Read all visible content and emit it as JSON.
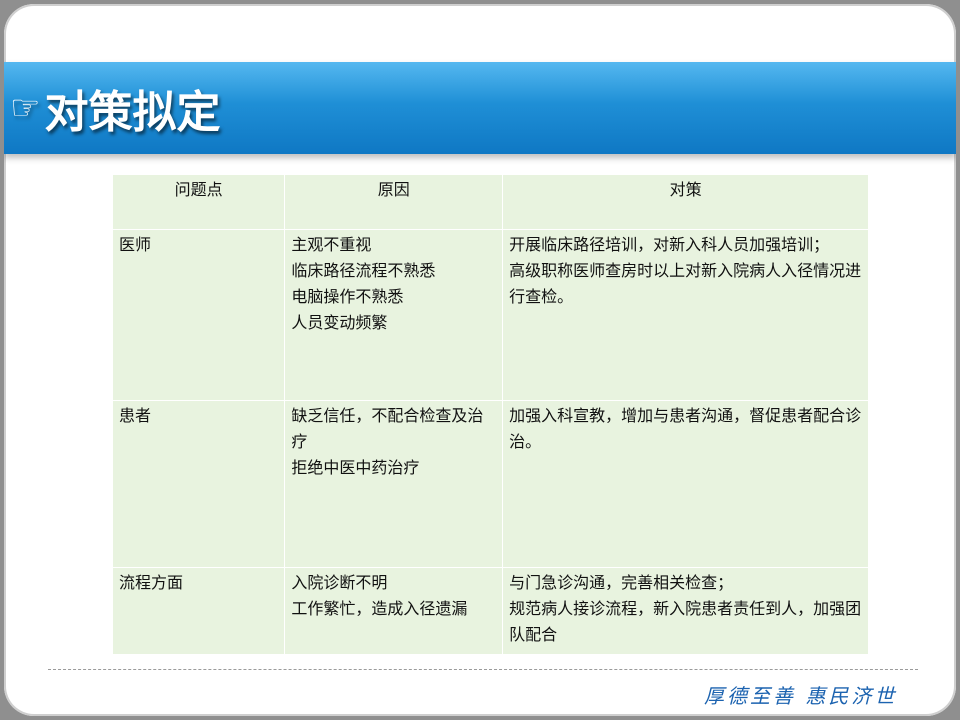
{
  "header": {
    "icon": "pointing-hand-icon",
    "icon_glyph": "☞",
    "title": "对策拟定"
  },
  "table": {
    "headers": [
      "问题点",
      "原因",
      "对策"
    ],
    "rows": [
      {
        "issue": "医师",
        "causes": [
          "主观不重视",
          "临床路径流程不熟悉",
          "电脑操作不熟悉",
          "人员变动频繁"
        ],
        "measures": [
          "开展临床路径培训，对新入科人员加强培训；",
          "高级职称医师查房时以上对新入院病人入径情况进行查检。"
        ]
      },
      {
        "issue": "患者",
        "causes": [
          "缺乏信任，不配合检查及治疗",
          "拒绝中医中药治疗"
        ],
        "measures": [
          "加强入科宣教，增加与患者沟通，督促患者配合诊治。"
        ]
      },
      {
        "issue": "流程方面",
        "causes": [
          "入院诊断不明",
          "工作繁忙，造成入径遗漏"
        ],
        "measures": [
          "与门急诊沟通，完善相关检查；",
          "规范病人接诊流程，新入院患者责任到人，加强团队配合"
        ]
      }
    ]
  },
  "footer": {
    "motto": "厚德至善  惠民济世"
  },
  "colors": {
    "banner": "#1f8fd6",
    "table_bg": "#e8f3df",
    "motto": "#1c63b0"
  }
}
